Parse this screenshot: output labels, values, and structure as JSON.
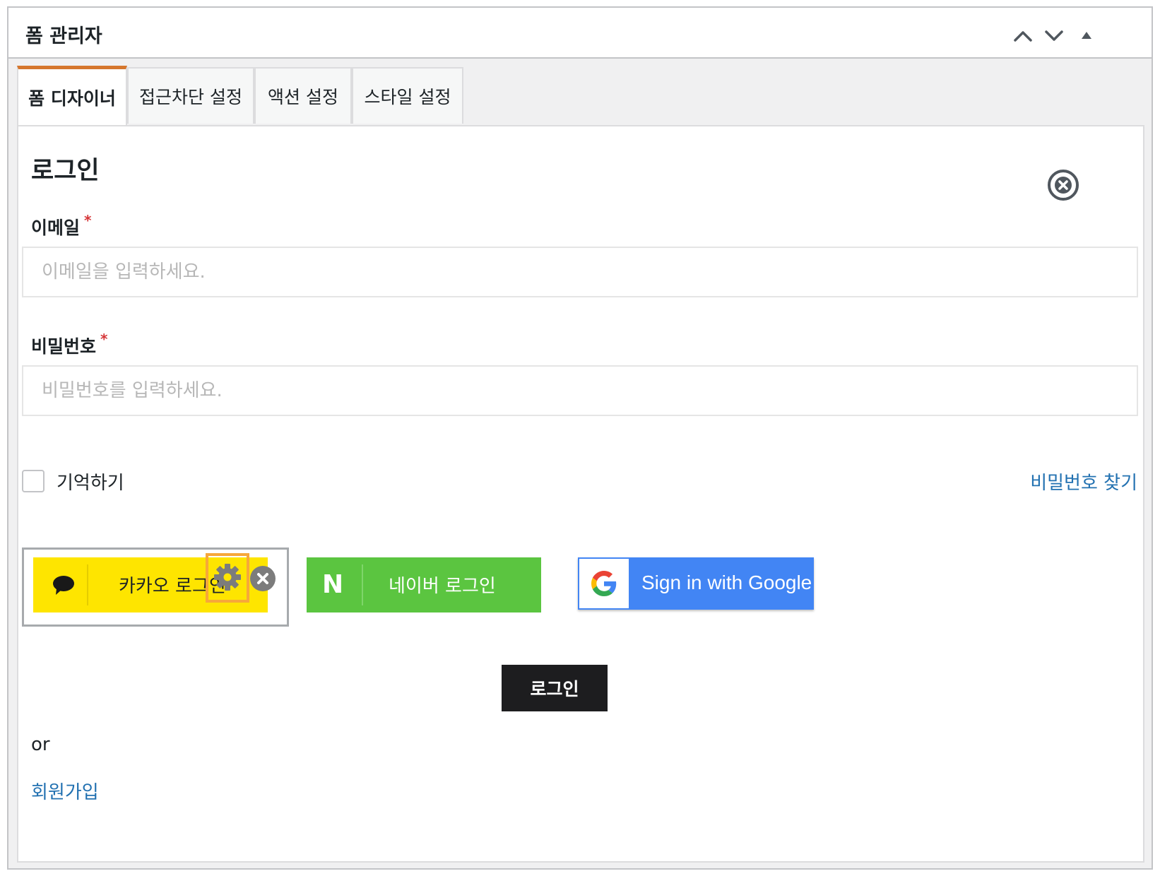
{
  "panel": {
    "title": "폼 관리자",
    "controls": [
      "chevron-up-icon",
      "chevron-down-icon",
      "triangle-up-icon"
    ]
  },
  "tabs": [
    {
      "label": "폼 디자이너",
      "active": true
    },
    {
      "label": "접근차단 설정",
      "active": false
    },
    {
      "label": "액션 설정",
      "active": false
    },
    {
      "label": "스타일 설정",
      "active": false
    }
  ],
  "form": {
    "title": "로그인",
    "email": {
      "label": "이메일",
      "required_mark": "*",
      "placeholder": "이메일을 입력하세요.",
      "value": ""
    },
    "password": {
      "label": "비밀번호",
      "required_mark": "*",
      "placeholder": "비밀번호를 입력하세요.",
      "value": ""
    },
    "remember": {
      "label": "기억하기",
      "checked": false
    },
    "find_password": "비밀번호 찾기",
    "social": {
      "kakao": {
        "label": "카카오 로그인",
        "color": "#fee500",
        "icon": "speech-bubble-icon"
      },
      "naver": {
        "label": "네이버 로그인",
        "logo": "N",
        "color": "#5bc540"
      },
      "google": {
        "label": "Sign in with Google",
        "color": "#4285f4",
        "icon": "google-g-icon"
      }
    },
    "submit_label": "로그인",
    "or_text": "or",
    "signup_link": "회원가입"
  },
  "colors": {
    "accent_tab": "#d5762d",
    "link": "#2271b1",
    "required": "#d63638",
    "selection_highlight": "#f6a83a"
  }
}
